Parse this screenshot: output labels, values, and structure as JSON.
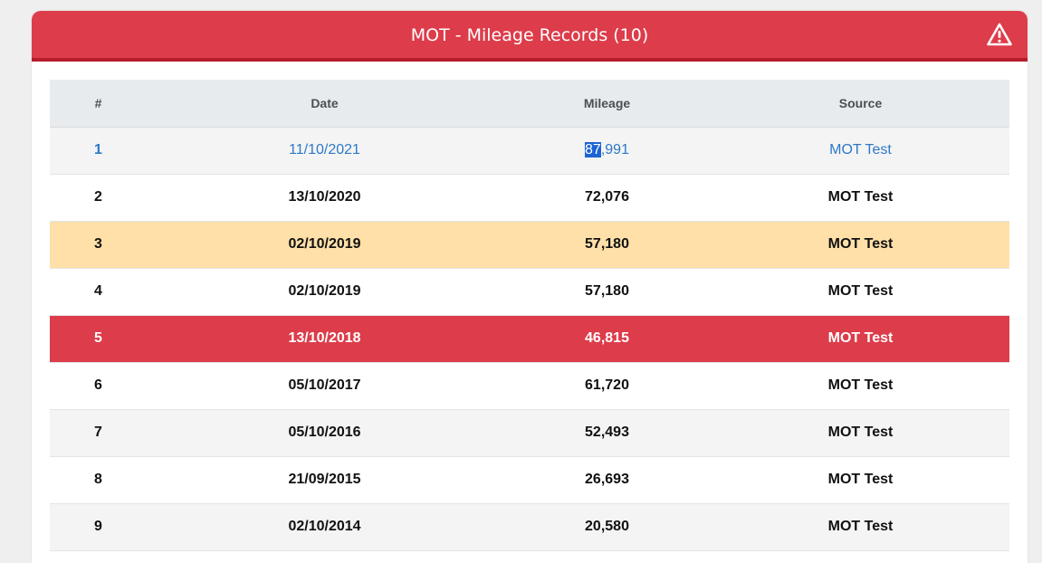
{
  "header": {
    "title": "MOT - Mileage Records (10)",
    "warning_icon": "warning-triangle-icon"
  },
  "table": {
    "columns": [
      "#",
      "Date",
      "Mileage",
      "Source"
    ],
    "rows": [
      {
        "index": "1",
        "date": "11/10/2021",
        "mileage_highlight": "87",
        "mileage_rest": ",991",
        "source": "MOT Test",
        "state": "selected"
      },
      {
        "index": "2",
        "date": "13/10/2020",
        "mileage": "72,076",
        "source": "MOT Test",
        "state": "normal"
      },
      {
        "index": "3",
        "date": "02/10/2019",
        "mileage": "57,180",
        "source": "MOT Test",
        "state": "warning"
      },
      {
        "index": "4",
        "date": "02/10/2019",
        "mileage": "57,180",
        "source": "MOT Test",
        "state": "normal"
      },
      {
        "index": "5",
        "date": "13/10/2018",
        "mileage": "46,815",
        "source": "MOT Test",
        "state": "danger"
      },
      {
        "index": "6",
        "date": "05/10/2017",
        "mileage": "61,720",
        "source": "MOT Test",
        "state": "normal"
      },
      {
        "index": "7",
        "date": "05/10/2016",
        "mileage": "52,493",
        "source": "MOT Test",
        "state": "normal"
      },
      {
        "index": "8",
        "date": "21/09/2015",
        "mileage": "26,693",
        "source": "MOT Test",
        "state": "normal"
      },
      {
        "index": "9",
        "date": "02/10/2014",
        "mileage": "20,580",
        "source": "MOT Test",
        "state": "normal"
      }
    ]
  },
  "colors": {
    "header_red": "#dd3c4a",
    "warning_row": "#ffe0a8",
    "danger_row": "#dd3c4a",
    "link_blue": "#2c79c7",
    "text_highlight": "#1d64d3"
  }
}
